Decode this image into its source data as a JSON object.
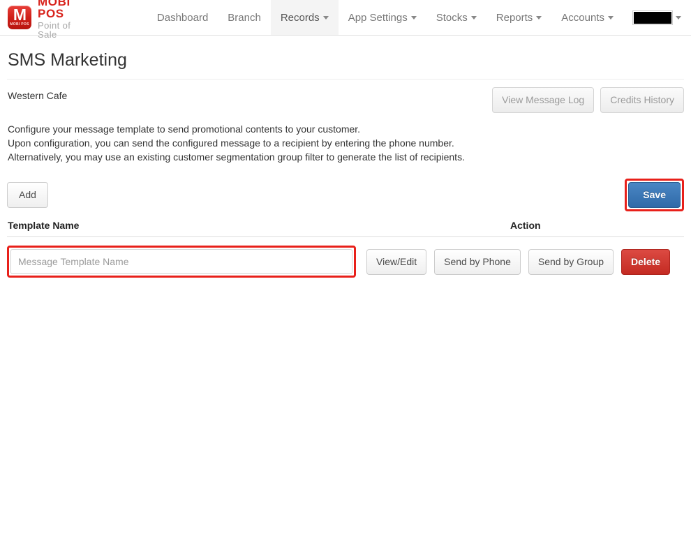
{
  "brand": {
    "mark_letter": "M",
    "mark_sub": "MOBI POS",
    "title": "MOBI POS",
    "tagline": "Point of Sale",
    "accent_color": "#d8231c"
  },
  "nav": {
    "items": [
      {
        "label": "Dashboard",
        "has_caret": false,
        "active": false
      },
      {
        "label": "Branch",
        "has_caret": false,
        "active": false
      },
      {
        "label": "Records",
        "has_caret": true,
        "active": true
      },
      {
        "label": "App Settings",
        "has_caret": true,
        "active": false
      },
      {
        "label": "Stocks",
        "has_caret": true,
        "active": false
      },
      {
        "label": "Reports",
        "has_caret": true,
        "active": false
      },
      {
        "label": "Accounts",
        "has_caret": true,
        "active": false
      }
    ],
    "account_label": ""
  },
  "page": {
    "title": "SMS Marketing",
    "branch": "Western Cafe"
  },
  "subhead_actions": {
    "view_message_log": "View Message Log",
    "credits_history": "Credits History"
  },
  "description": {
    "line1": "Configure your message template to send promotional contents to your customer.",
    "line2": "Upon configuration, you can send the configured message to a recipient by entering the phone number.",
    "line3": "Alternatively, you may use an existing customer segmentation group filter to generate the list of recipients."
  },
  "toolbar": {
    "add_label": "Add",
    "save_label": "Save",
    "save_highlight_color": "#e8201a",
    "save_color": "#2f6aa8"
  },
  "table": {
    "headers": {
      "name": "Template Name",
      "action": "Action"
    },
    "rows": [
      {
        "template_name_value": "",
        "template_name_placeholder": "Message Template Name",
        "highlight_color": "#e8201a",
        "actions": {
          "view_edit": "View/Edit",
          "send_by_phone": "Send by Phone",
          "send_by_group": "Send by Group",
          "delete": "Delete",
          "delete_color": "#c42b23"
        }
      }
    ]
  }
}
